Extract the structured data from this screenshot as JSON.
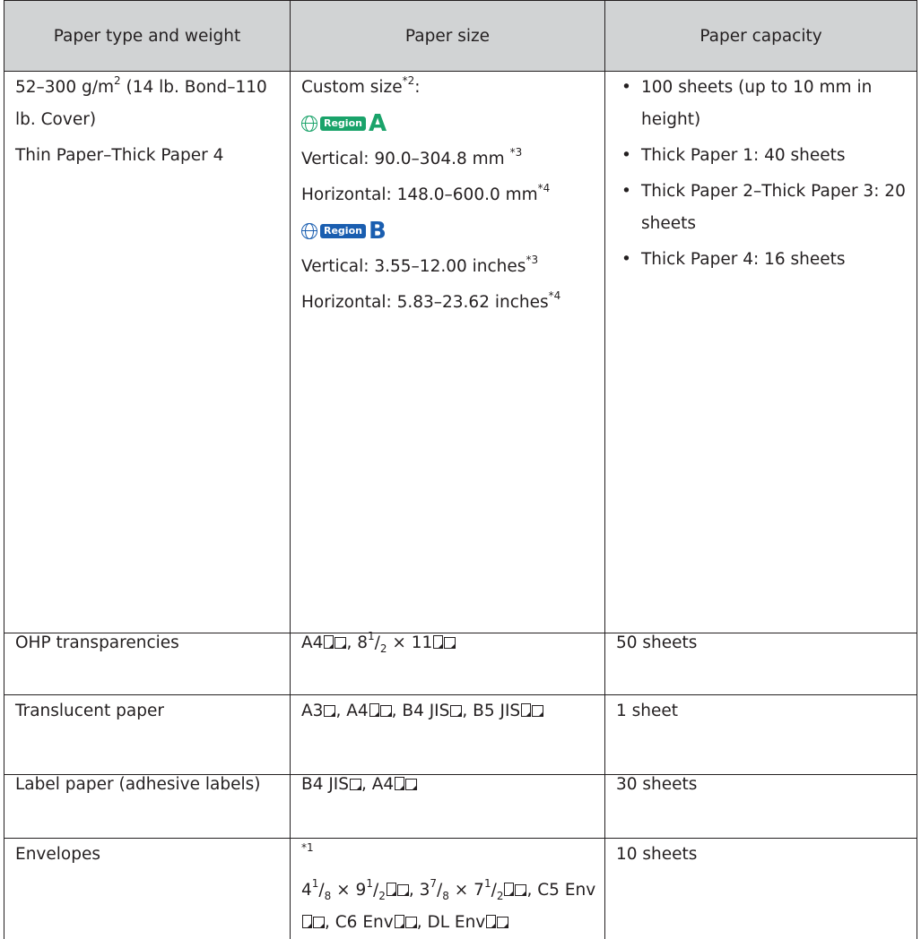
{
  "header": {
    "col1": "Paper type and weight",
    "col2": "Paper size",
    "col3": "Paper capacity"
  },
  "row1": {
    "type_line1_pre": "52–300 g/m",
    "type_line1_sup": "2",
    "type_line1_post": " (14 lb. Bond–110 lb. Cover)",
    "type_line2": "Thin Paper–Thick Paper 4",
    "custom_size_label": "Custom size",
    "custom_size_note": "*2",
    "custom_size_colon": ":",
    "region_a_tag": "Region",
    "region_a_letter": "A",
    "region_a_vertical": "Vertical: 90.0–304.8 mm ",
    "region_a_vertical_note": "*3",
    "region_a_horizontal": "Horizontal: 148.0–600.0 mm",
    "region_a_horizontal_note": "*4",
    "region_b_tag": "Region",
    "region_b_letter": "B",
    "region_b_vertical": "Vertical: 3.55–12.00 inches",
    "region_b_vertical_note": "*3",
    "region_b_horizontal": "Horizontal: 5.83–23.62 inches",
    "region_b_horizontal_note": "*4",
    "capacity": [
      "100 sheets (up to 10 mm in height)",
      "Thick Paper 1: 40 sheets",
      "Thick Paper 2–Thick Paper 3: 20 sheets",
      "Thick Paper 4: 16 sheets"
    ],
    "bullet": "•"
  },
  "row2": {
    "type": "OHP transparencies",
    "size_a4": "A4",
    "size_sep": ", 8",
    "size_frac_num": "1",
    "size_frac_slash": "/",
    "size_frac_den": "2",
    "size_times": " × 11",
    "capacity": "50 sheets"
  },
  "row3": {
    "type": "Translucent paper",
    "s1": "A3",
    "s2": ", A4",
    "s3": ", B4 JIS",
    "s4": ", B5 JIS",
    "capacity": "1 sheet"
  },
  "row4": {
    "type": "Label paper (adhesive labels)",
    "s1": "B4 JIS",
    "s2": ", A4",
    "capacity": "30 sheets"
  },
  "row5": {
    "type": "Envelopes",
    "note": "*1",
    "e1_whole": "4",
    "e1_num": "1",
    "e1_den": "8",
    "e1_times": " × 9",
    "e1b_num": "1",
    "e1b_den": "2",
    "e2_whole": ", 3",
    "e2_num": "7",
    "e2_den": "8",
    "e2_times": " × 7",
    "e2b_num": "1",
    "e2b_den": "2",
    "e3": ", C5 Env",
    "e4": ", C6 Env",
    "e5": ", DL Env",
    "slash": "/",
    "capacity": "10 sheets"
  },
  "orientation_icons": {
    "portrait": "portrait-feed-icon",
    "landscape": "landscape-feed-icon"
  },
  "colors": {
    "header_bg": "#d1d3d4",
    "text": "#231f20",
    "region_a": "#1aa36a",
    "region_b": "#1a5eb0"
  }
}
